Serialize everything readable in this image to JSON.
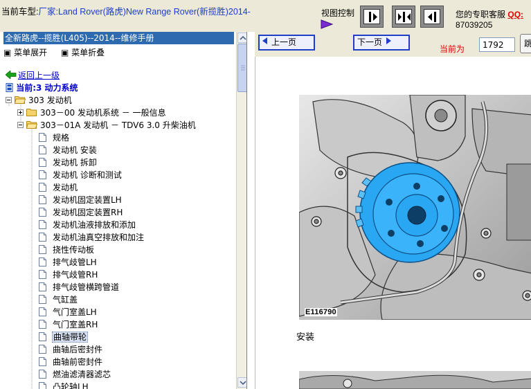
{
  "header": {
    "car_label": "当前车型:",
    "car_value": "厂家:Land Rover(路虎)New Range Rover(新揽胜)2014-",
    "view_control_label": "视图控制",
    "support_text": "您的专职客服",
    "support_qq_label": "QQ:",
    "support_phone": "87039205"
  },
  "left_panel": {
    "manual_title": "全新路虎--揽胜(L405)--2014--维修手册",
    "expand_menu_label": "菜单展开",
    "collapse_menu_label": "菜单折叠",
    "back_link": "返回上一级",
    "current_system": "当前:3 动力系统",
    "tree": {
      "root": "303 发动机",
      "group1": "303－00 发动机系统 － 一般信息",
      "group2": "303－01A 发动机 － TDV6 3.0 升柴油机",
      "items": [
        "规格",
        "发动机 安装",
        "发动机 拆卸",
        "发动机 诊断和测试",
        "发动机",
        "发动机固定装置LH",
        "发动机固定装置RH",
        "发动机油液排放和添加",
        "发动机油真空排放和加注",
        "挠性传动板",
        "排气歧管LH",
        "排气歧管RH",
        "排气歧管横跨管道",
        "气缸盖",
        "气门室盖LH",
        "气门室盖RH",
        "曲轴带轮",
        "曲轴后密封件",
        "曲轴前密封件",
        "燃油滤清器滤芯",
        "凸轮轴LH"
      ],
      "selected_item": "曲轴带轮"
    }
  },
  "right_panel": {
    "prev_page": "上一页",
    "next_page": "下一页",
    "current_label": "当前为",
    "page_number": "1792",
    "jump_label": "跳转",
    "figure_code": "E116790",
    "section_heading": "安装"
  },
  "colors": {
    "topbar_bg": "#ece9d8",
    "title_blue": "#1a3bd4",
    "manual_title_bg": "#2d6ab0",
    "accent_red": "#e00000",
    "pulley_blue": "#2aa7f2"
  }
}
